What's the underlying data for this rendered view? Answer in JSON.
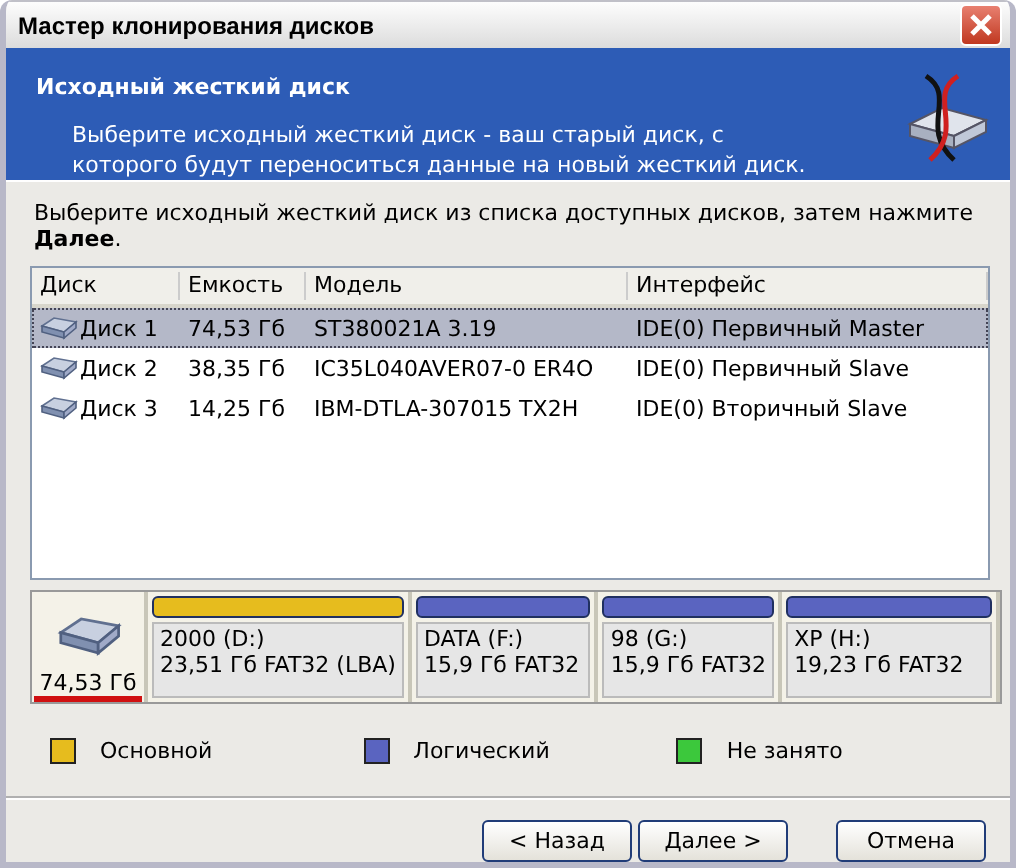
{
  "window": {
    "title": "Мастер клонирования дисков"
  },
  "header": {
    "title": "Исходный жесткий диск",
    "description": "Выберите исходный жесткий диск - ваш старый диск, с которого будут переноситься данные на новый жесткий диск."
  },
  "instruction": "Выберите исходный жесткий диск из списка доступных дисков, затем нажмите **Далее**.",
  "table": {
    "columns": [
      "Диск",
      "Емкость",
      "Модель",
      "Интерфейс"
    ],
    "rows": [
      {
        "disk": "Диск 1",
        "capacity": "74,53 Гб",
        "model": "ST380021A 3.19",
        "interface": "IDE(0) Первичный Master",
        "selected": true
      },
      {
        "disk": "Диск 2",
        "capacity": "38,35 Гб",
        "model": "IC35L040AVER07-0 ER4O",
        "interface": "IDE(0) Первичный Slave",
        "selected": false
      },
      {
        "disk": "Диск 3",
        "capacity": "14,25 Гб",
        "model": "IBM-DTLA-307015 TX2H",
        "interface": "IDE(0) Вторичный Slave",
        "selected": false
      }
    ]
  },
  "disk_map": {
    "size": "74,53 Гб",
    "partitions": [
      {
        "kind": "primary",
        "name": "2000 (D:)",
        "info": "23,51 Гб  FAT32 (LBA)"
      },
      {
        "kind": "logical",
        "name": "DATA (F:)",
        "info": "15,9 Гб  FAT32"
      },
      {
        "kind": "logical",
        "name": "98 (G:)",
        "info": "15,9 Гб  FAT32"
      },
      {
        "kind": "logical",
        "name": "XP (H:)",
        "info": "19,23 Гб  FAT32"
      }
    ]
  },
  "legend": [
    {
      "label": "Основной",
      "color": "#e6bc1e"
    },
    {
      "label": "Логический",
      "color": "#5a64c0"
    },
    {
      "label": "Не занято",
      "color": "#3cc83c"
    }
  ],
  "buttons": [
    "< Назад",
    "Далее >",
    "Отмена"
  ]
}
